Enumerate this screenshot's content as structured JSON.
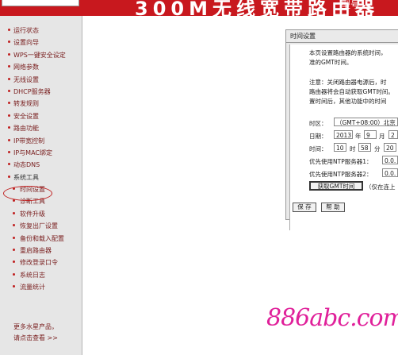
{
  "banner": {
    "title": "300M无线宽带路由器",
    "subtitle": "型号："
  },
  "sidebar": {
    "items": [
      {
        "label": "运行状态",
        "sub": false
      },
      {
        "label": "设置向导",
        "sub": false
      },
      {
        "label": "WPS一键安全设定",
        "sub": false
      },
      {
        "label": "网络参数",
        "sub": false
      },
      {
        "label": "无线设置",
        "sub": false
      },
      {
        "label": "DHCP服务器",
        "sub": false
      },
      {
        "label": "转发规则",
        "sub": false
      },
      {
        "label": "安全设置",
        "sub": false
      },
      {
        "label": "路由功能",
        "sub": false
      },
      {
        "label": "IP带宽控制",
        "sub": false
      },
      {
        "label": "IP与MAC绑定",
        "sub": false
      },
      {
        "label": "动态DNS",
        "sub": false
      },
      {
        "label": "系统工具",
        "sub": false,
        "selected": true
      },
      {
        "label": "时间设置",
        "sub": true
      },
      {
        "label": "诊断工具",
        "sub": true
      },
      {
        "label": "软件升级",
        "sub": true
      },
      {
        "label": "恢复出厂设置",
        "sub": true
      },
      {
        "label": "备份和载入配置",
        "sub": true
      },
      {
        "label": "重启路由器",
        "sub": true
      },
      {
        "label": "修改登录口令",
        "sub": true
      },
      {
        "label": "系统日志",
        "sub": true
      },
      {
        "label": "流量统计",
        "sub": true
      }
    ],
    "more_line1": "更多水星产品，",
    "more_line2": "请点击查看 >>"
  },
  "panel": {
    "title": "时间设置",
    "desc1": "本页设置路由器的系统时间，",
    "desc2": "准的GMT时间。",
    "note1": "注意：关闭路由器电源后，时",
    "note2": "路由器将会自动获取GMT时间。",
    "note3": "置时间后，其他功能中的时间",
    "timezone_label": "时区：",
    "timezone_value": "（GMT+08:00）北京",
    "date_label": "日期：",
    "year": "2013",
    "year_unit": "年",
    "month": "9",
    "month_unit": "月",
    "day": "2",
    "time_label": "时间：",
    "hour": "10",
    "hour_unit": "时",
    "minute": "58",
    "minute_unit": "分",
    "second": "20",
    "ntp1_label": "优先使用NTP服务器1：",
    "ntp1_value": "0.0.",
    "ntp2_label": "优先使用NTP服务器2：",
    "ntp2_value": "0.0.",
    "get_gmt_button": "获取GMT时间",
    "get_gmt_hint": "（仅在连上",
    "save_button": "保 存",
    "help_button": "帮 助"
  },
  "watermark": {
    "text": "886abc.com"
  },
  "colors": {
    "banner": "#c8181e",
    "sidebar_text": "#7a2020",
    "watermark": "#e0209a"
  }
}
